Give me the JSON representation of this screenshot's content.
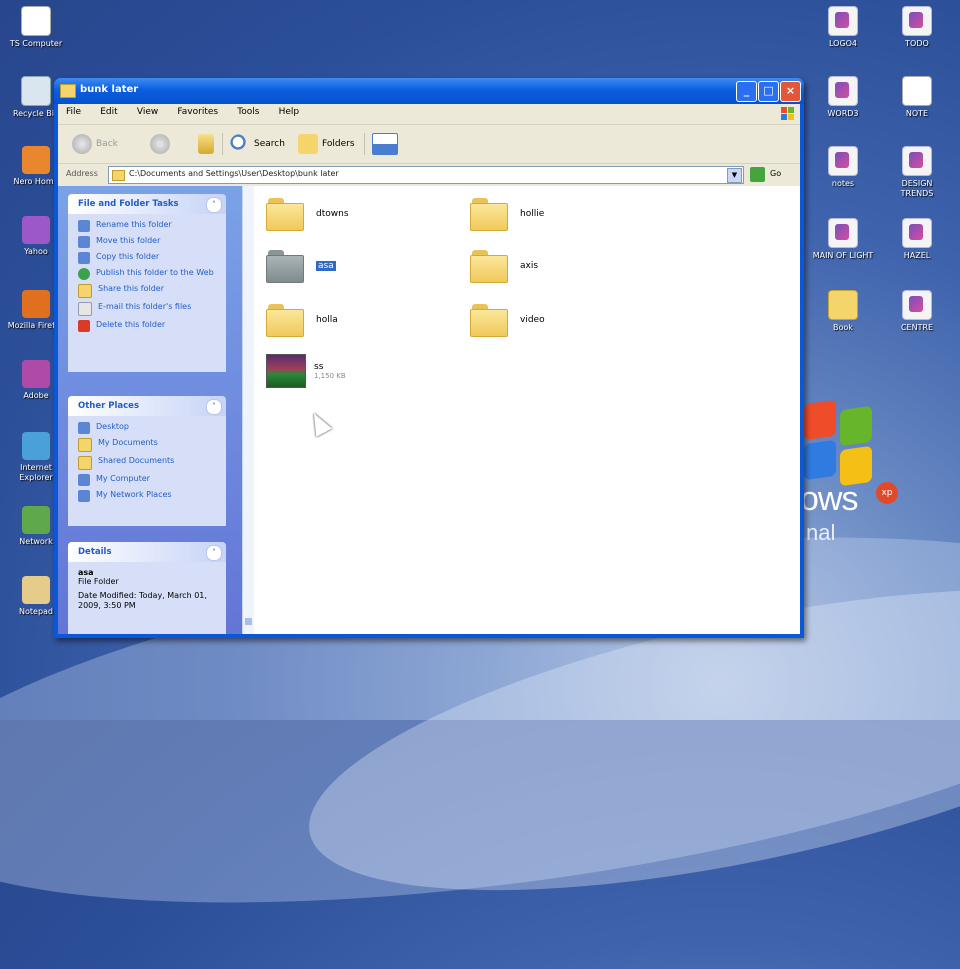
{
  "desktop": {
    "left_icons": [
      {
        "label": "TS Computer",
        "glyph": "computer-icon"
      },
      {
        "label": "Recycle Bin",
        "glyph": "recycle-bin-icon"
      },
      {
        "label": "Nero Home",
        "glyph": "orange-app-icon"
      },
      {
        "label": "Yahoo",
        "glyph": "purple-app-icon"
      },
      {
        "label": "Mozilla Firefox",
        "glyph": "firefox-icon"
      },
      {
        "label": "Adobe",
        "glyph": "flower-app-icon"
      },
      {
        "label": "Internet Explorer",
        "glyph": "globe-icon"
      },
      {
        "label": "Network",
        "glyph": "network-icon"
      },
      {
        "label": "Notepad",
        "glyph": "notepad-icon"
      }
    ],
    "right_icons": [
      {
        "label": "LOGO4",
        "glyph": "document-icon"
      },
      {
        "label": "TODO",
        "glyph": "document-icon"
      },
      {
        "label": "WORD3",
        "glyph": "document-icon"
      },
      {
        "label": "NOTE",
        "glyph": "text-file-icon"
      },
      {
        "label": "notes",
        "glyph": "document-icon"
      },
      {
        "label": "DESIGN TRENDS",
        "glyph": "document-icon"
      },
      {
        "label": "MAIN OF LIGHT",
        "glyph": "document-icon"
      },
      {
        "label": "HAZEL",
        "glyph": "document-icon"
      },
      {
        "label": "Book",
        "glyph": "folder-icon"
      },
      {
        "label": "CENTRE",
        "glyph": "document-icon"
      }
    ],
    "os_logo_text": "ows",
    "os_logo_sub": "nal",
    "os_logo_badge": "xp"
  },
  "window": {
    "title": "bunk later",
    "buttons": {
      "minimize": "_",
      "maximize": "□",
      "close": "×"
    },
    "menu": [
      "File",
      "Edit",
      "View",
      "Favorites",
      "Tools",
      "Help"
    ],
    "toolbar": {
      "back": "Back",
      "search": "Search",
      "folders": "Folders"
    },
    "address": {
      "label": "Address",
      "path": "C:\\Documents and Settings\\User\\Desktop\\bunk later",
      "go": "Go"
    }
  },
  "taskpane": {
    "file_folder_tasks": {
      "title": "File and Folder Tasks",
      "items": [
        {
          "label": "Rename this folder",
          "icon": "rename-icon"
        },
        {
          "label": "Move this folder",
          "icon": "move-icon"
        },
        {
          "label": "Copy this folder",
          "icon": "copy-icon"
        },
        {
          "label": "Publish this folder to the Web",
          "icon": "publish-icon"
        },
        {
          "label": "Share this folder",
          "icon": "share-icon"
        },
        {
          "label": "E-mail this folder's files",
          "icon": "email-icon"
        },
        {
          "label": "Delete this folder",
          "icon": "delete-icon"
        }
      ]
    },
    "other_places": {
      "title": "Other Places",
      "items": [
        {
          "label": "Desktop",
          "icon": "desktop-icon"
        },
        {
          "label": "My Documents",
          "icon": "documents-icon"
        },
        {
          "label": "Shared Documents",
          "icon": "shared-folder-icon"
        },
        {
          "label": "My Computer",
          "icon": "computer-icon"
        },
        {
          "label": "My Network Places",
          "icon": "network-icon"
        }
      ]
    },
    "details": {
      "title": "Details",
      "name": "asa",
      "type": "File Folder",
      "modified": "Date Modified: Today, March 01, 2009, 3:50 PM"
    }
  },
  "files": [
    {
      "name": "dtowns",
      "kind": "folder"
    },
    {
      "name": "hollie",
      "kind": "folder"
    },
    {
      "name": "asa",
      "kind": "folder",
      "selected": true
    },
    {
      "name": "axis",
      "kind": "folder"
    },
    {
      "name": "holla",
      "kind": "folder"
    },
    {
      "name": "video",
      "kind": "folder"
    },
    {
      "name": "ss",
      "kind": "image",
      "sub": "1,150 KB"
    }
  ]
}
